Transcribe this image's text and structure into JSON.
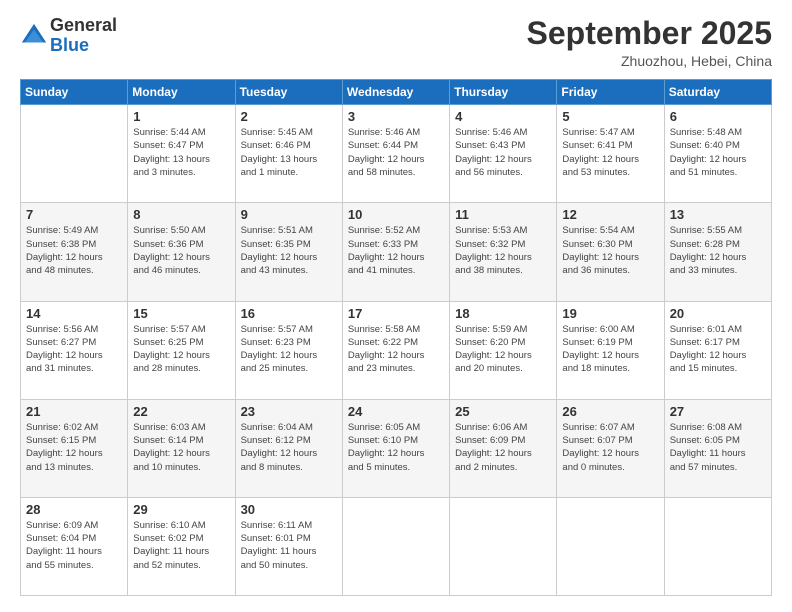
{
  "header": {
    "logo": {
      "line1": "General",
      "line2": "Blue"
    },
    "title": "September 2025",
    "location": "Zhuozhou, Hebei, China"
  },
  "weekdays": [
    "Sunday",
    "Monday",
    "Tuesday",
    "Wednesday",
    "Thursday",
    "Friday",
    "Saturday"
  ],
  "weeks": [
    [
      {
        "day": "",
        "info": ""
      },
      {
        "day": "1",
        "info": "Sunrise: 5:44 AM\nSunset: 6:47 PM\nDaylight: 13 hours\nand 3 minutes."
      },
      {
        "day": "2",
        "info": "Sunrise: 5:45 AM\nSunset: 6:46 PM\nDaylight: 13 hours\nand 1 minute."
      },
      {
        "day": "3",
        "info": "Sunrise: 5:46 AM\nSunset: 6:44 PM\nDaylight: 12 hours\nand 58 minutes."
      },
      {
        "day": "4",
        "info": "Sunrise: 5:46 AM\nSunset: 6:43 PM\nDaylight: 12 hours\nand 56 minutes."
      },
      {
        "day": "5",
        "info": "Sunrise: 5:47 AM\nSunset: 6:41 PM\nDaylight: 12 hours\nand 53 minutes."
      },
      {
        "day": "6",
        "info": "Sunrise: 5:48 AM\nSunset: 6:40 PM\nDaylight: 12 hours\nand 51 minutes."
      }
    ],
    [
      {
        "day": "7",
        "info": "Sunrise: 5:49 AM\nSunset: 6:38 PM\nDaylight: 12 hours\nand 48 minutes."
      },
      {
        "day": "8",
        "info": "Sunrise: 5:50 AM\nSunset: 6:36 PM\nDaylight: 12 hours\nand 46 minutes."
      },
      {
        "day": "9",
        "info": "Sunrise: 5:51 AM\nSunset: 6:35 PM\nDaylight: 12 hours\nand 43 minutes."
      },
      {
        "day": "10",
        "info": "Sunrise: 5:52 AM\nSunset: 6:33 PM\nDaylight: 12 hours\nand 41 minutes."
      },
      {
        "day": "11",
        "info": "Sunrise: 5:53 AM\nSunset: 6:32 PM\nDaylight: 12 hours\nand 38 minutes."
      },
      {
        "day": "12",
        "info": "Sunrise: 5:54 AM\nSunset: 6:30 PM\nDaylight: 12 hours\nand 36 minutes."
      },
      {
        "day": "13",
        "info": "Sunrise: 5:55 AM\nSunset: 6:28 PM\nDaylight: 12 hours\nand 33 minutes."
      }
    ],
    [
      {
        "day": "14",
        "info": "Sunrise: 5:56 AM\nSunset: 6:27 PM\nDaylight: 12 hours\nand 31 minutes."
      },
      {
        "day": "15",
        "info": "Sunrise: 5:57 AM\nSunset: 6:25 PM\nDaylight: 12 hours\nand 28 minutes."
      },
      {
        "day": "16",
        "info": "Sunrise: 5:57 AM\nSunset: 6:23 PM\nDaylight: 12 hours\nand 25 minutes."
      },
      {
        "day": "17",
        "info": "Sunrise: 5:58 AM\nSunset: 6:22 PM\nDaylight: 12 hours\nand 23 minutes."
      },
      {
        "day": "18",
        "info": "Sunrise: 5:59 AM\nSunset: 6:20 PM\nDaylight: 12 hours\nand 20 minutes."
      },
      {
        "day": "19",
        "info": "Sunrise: 6:00 AM\nSunset: 6:19 PM\nDaylight: 12 hours\nand 18 minutes."
      },
      {
        "day": "20",
        "info": "Sunrise: 6:01 AM\nSunset: 6:17 PM\nDaylight: 12 hours\nand 15 minutes."
      }
    ],
    [
      {
        "day": "21",
        "info": "Sunrise: 6:02 AM\nSunset: 6:15 PM\nDaylight: 12 hours\nand 13 minutes."
      },
      {
        "day": "22",
        "info": "Sunrise: 6:03 AM\nSunset: 6:14 PM\nDaylight: 12 hours\nand 10 minutes."
      },
      {
        "day": "23",
        "info": "Sunrise: 6:04 AM\nSunset: 6:12 PM\nDaylight: 12 hours\nand 8 minutes."
      },
      {
        "day": "24",
        "info": "Sunrise: 6:05 AM\nSunset: 6:10 PM\nDaylight: 12 hours\nand 5 minutes."
      },
      {
        "day": "25",
        "info": "Sunrise: 6:06 AM\nSunset: 6:09 PM\nDaylight: 12 hours\nand 2 minutes."
      },
      {
        "day": "26",
        "info": "Sunrise: 6:07 AM\nSunset: 6:07 PM\nDaylight: 12 hours\nand 0 minutes."
      },
      {
        "day": "27",
        "info": "Sunrise: 6:08 AM\nSunset: 6:05 PM\nDaylight: 11 hours\nand 57 minutes."
      }
    ],
    [
      {
        "day": "28",
        "info": "Sunrise: 6:09 AM\nSunset: 6:04 PM\nDaylight: 11 hours\nand 55 minutes."
      },
      {
        "day": "29",
        "info": "Sunrise: 6:10 AM\nSunset: 6:02 PM\nDaylight: 11 hours\nand 52 minutes."
      },
      {
        "day": "30",
        "info": "Sunrise: 6:11 AM\nSunset: 6:01 PM\nDaylight: 11 hours\nand 50 minutes."
      },
      {
        "day": "",
        "info": ""
      },
      {
        "day": "",
        "info": ""
      },
      {
        "day": "",
        "info": ""
      },
      {
        "day": "",
        "info": ""
      }
    ]
  ]
}
